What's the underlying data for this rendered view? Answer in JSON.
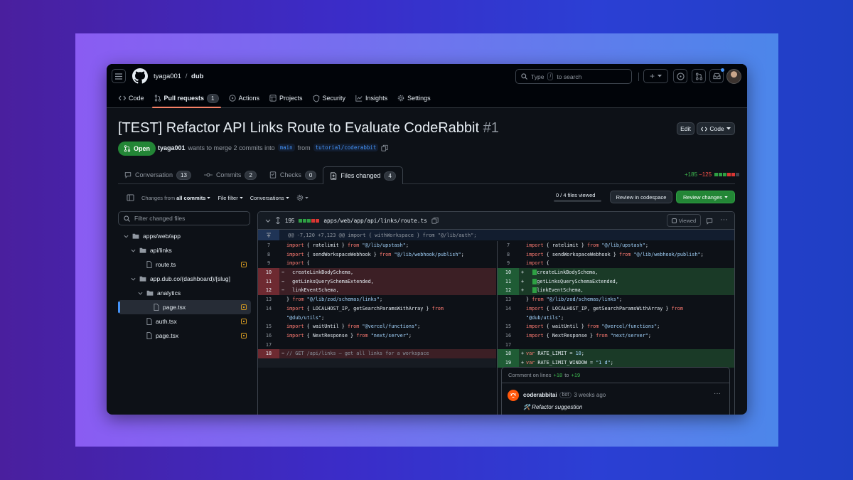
{
  "header": {
    "owner": "tyaga001",
    "separator": "/",
    "repo": "dub",
    "search_text": "Type",
    "search_key": "/",
    "search_suffix": "to search",
    "plus_label": "+"
  },
  "nav": [
    {
      "label": "Code",
      "icon": "code-icon"
    },
    {
      "label": "Pull requests",
      "count": "1",
      "icon": "git-pull-request-icon"
    },
    {
      "label": "Actions",
      "icon": "play-icon"
    },
    {
      "label": "Projects",
      "icon": "table-icon"
    },
    {
      "label": "Security",
      "icon": "shield-icon"
    },
    {
      "label": "Insights",
      "icon": "graph-icon"
    },
    {
      "label": "Settings",
      "icon": "gear-icon"
    }
  ],
  "pr": {
    "title": "[TEST] Refactor API Links Route to Evaluate CodeRabbit",
    "number": "#1",
    "edit_label": "Edit",
    "code_label": "Code",
    "state": "Open",
    "author": "tyaga001",
    "merge_text": "wants to merge 2 commits into",
    "base": "main",
    "from_text": "from",
    "head": "tutorial/coderabbit"
  },
  "pr_tabs": [
    {
      "label": "Conversation",
      "count": "13",
      "icon": "comment-icon"
    },
    {
      "label": "Commits",
      "count": "2",
      "icon": "commit-icon"
    },
    {
      "label": "Checks",
      "count": "0",
      "icon": "checklist-icon"
    },
    {
      "label": "Files changed",
      "count": "4",
      "icon": "file-diff-icon"
    }
  ],
  "diffstat": {
    "additions": "+185",
    "deletions": "−125",
    "colors": [
      "#2ea043",
      "#2ea043",
      "#2ea043",
      "#da3633",
      "#da3633"
    ]
  },
  "toolbar": {
    "changes_prefix": "Changes from",
    "changes_value": "all commits",
    "file_filter": "File filter",
    "conversations": "Conversations",
    "viewed": "0 / 4 files viewed",
    "review_codespace": "Review in codespace",
    "review_changes": "Review changes"
  },
  "filetree": {
    "filter_placeholder": "Filter changed files",
    "nodes": [
      {
        "label": "apps/web/app",
        "type": "folder",
        "depth": 0
      },
      {
        "label": "api/links",
        "type": "folder",
        "depth": 1
      },
      {
        "label": "route.ts",
        "type": "file",
        "depth": 2
      },
      {
        "label": "app.dub.co/(dashboard)/[slug]",
        "type": "folder",
        "depth": 1
      },
      {
        "label": "analytics",
        "type": "folder",
        "depth": 2
      },
      {
        "label": "page.tsx",
        "type": "file",
        "depth": 3
      },
      {
        "label": "auth.tsx",
        "type": "file",
        "depth": 2
      },
      {
        "label": "page.tsx",
        "type": "file",
        "depth": 2
      }
    ]
  },
  "diff": {
    "count": "195",
    "path": "apps/web/app/api/links/route.ts",
    "viewed_label": "Viewed",
    "hunk": "@@ -7,120 +7,123 @@ import { withWorkspace } from \"@/lib/auth\";",
    "comment_header_prefix": "Comment on lines",
    "comment_from": "+18",
    "comment_to_word": "to",
    "comment_to": "+19",
    "comment_author": "coderabbitai",
    "comment_badge": "bot",
    "comment_time": "3 weeks ago",
    "comment_body": "🛠️ Refactor suggestion",
    "comment_more": "···"
  }
}
